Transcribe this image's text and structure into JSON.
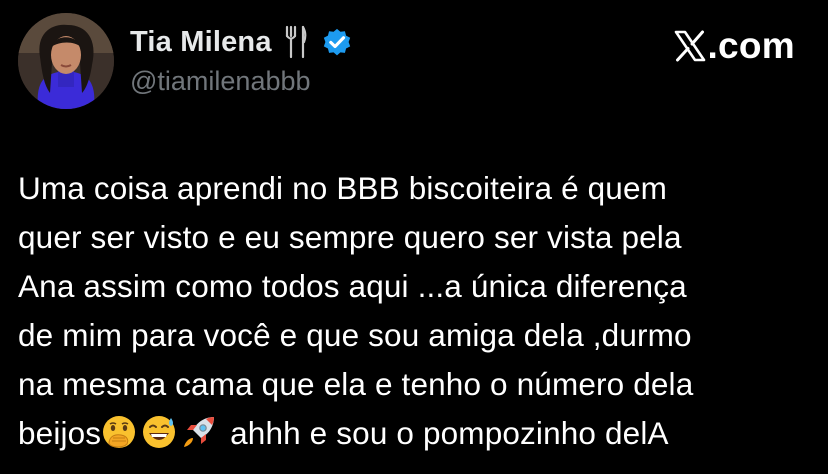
{
  "header": {
    "display_name": "Tia Milena",
    "handle": "@tiamilenabbb",
    "name_emoji_icon": "fork-and-knife-icon",
    "verified_icon": "verified-badge-icon",
    "verified_color": "#1d9bf0",
    "avatar_icon": "profile-photo"
  },
  "brand": {
    "logo_icon": "x-logo-icon",
    "text": ".com"
  },
  "tweet": {
    "lines": [
      "Uma coisa aprendi no BBB biscoiteira é quem",
      "quer ser visto e eu sempre quero ser vista pela",
      "Ana assim como todos aqui ...a única diferença",
      "de mim para você e que sou amiga dela ,durmo",
      "na mesma cama que ela e tenho o número dela"
    ],
    "last_line": {
      "prefix": "beijos",
      "emojis": [
        "face-with-hand-over-mouth-icon",
        "grinning-sweat-icon",
        "rocket-icon"
      ],
      "suffix": " ahhh e sou o pompozinho delA"
    }
  },
  "colors": {
    "background": "#000000",
    "text": "#ffffff",
    "muted": "#71767b"
  }
}
